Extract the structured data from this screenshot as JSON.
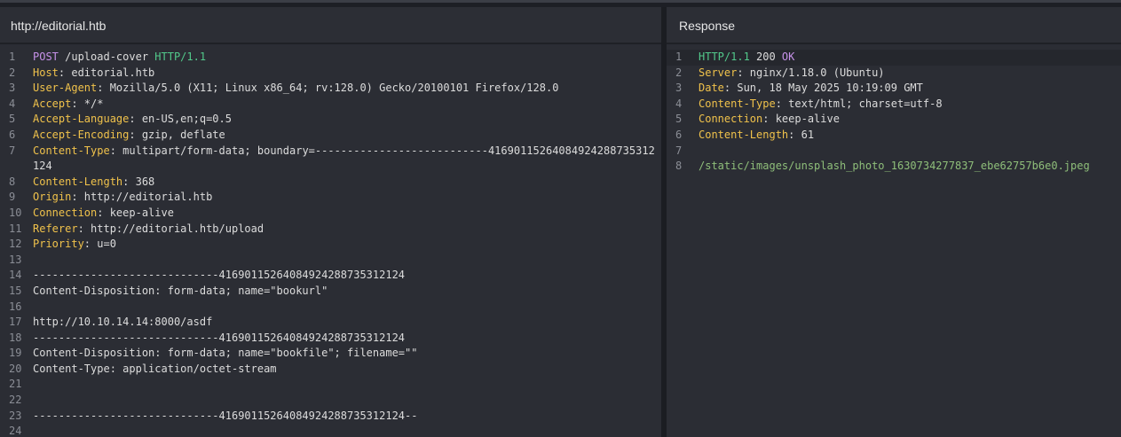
{
  "request": {
    "title": "http://editorial.htb",
    "lines": [
      {
        "n": "1",
        "parts": [
          {
            "t": "POST",
            "c": "method"
          },
          {
            "t": " /upload-cover ",
            "c": "plain"
          },
          {
            "t": "HTTP/1.1",
            "c": "proto"
          }
        ]
      },
      {
        "n": "2",
        "parts": [
          {
            "t": "Host",
            "c": "hname"
          },
          {
            "t": ": editorial.htb",
            "c": "plain"
          }
        ]
      },
      {
        "n": "3",
        "parts": [
          {
            "t": "User-Agent",
            "c": "hname"
          },
          {
            "t": ": Mozilla/5.0 (X11; Linux x86_64; rv:128.0) Gecko/20100101 Firefox/128.0",
            "c": "plain"
          }
        ]
      },
      {
        "n": "4",
        "parts": [
          {
            "t": "Accept",
            "c": "hname"
          },
          {
            "t": ": */*",
            "c": "plain"
          }
        ]
      },
      {
        "n": "5",
        "parts": [
          {
            "t": "Accept-Language",
            "c": "hname"
          },
          {
            "t": ": en-US,en;q=0.5",
            "c": "plain"
          }
        ]
      },
      {
        "n": "6",
        "parts": [
          {
            "t": "Accept-Encoding",
            "c": "hname"
          },
          {
            "t": ": gzip, deflate",
            "c": "plain"
          }
        ]
      },
      {
        "n": "7",
        "parts": [
          {
            "t": "Content-Type",
            "c": "hname"
          },
          {
            "t": ": multipart/form-data; boundary=---------------------------41690115264084924288735312124",
            "c": "plain"
          }
        ]
      },
      {
        "n": "8",
        "parts": [
          {
            "t": "Content-Length",
            "c": "hname"
          },
          {
            "t": ": 368",
            "c": "plain"
          }
        ]
      },
      {
        "n": "9",
        "parts": [
          {
            "t": "Origin",
            "c": "hname"
          },
          {
            "t": ": http://editorial.htb",
            "c": "plain"
          }
        ]
      },
      {
        "n": "10",
        "parts": [
          {
            "t": "Connection",
            "c": "hname"
          },
          {
            "t": ": keep-alive",
            "c": "plain"
          }
        ]
      },
      {
        "n": "11",
        "parts": [
          {
            "t": "Referer",
            "c": "hname"
          },
          {
            "t": ": http://editorial.htb/upload",
            "c": "plain"
          }
        ]
      },
      {
        "n": "12",
        "parts": [
          {
            "t": "Priority",
            "c": "hname"
          },
          {
            "t": ": u=0",
            "c": "plain"
          }
        ]
      },
      {
        "n": "13",
        "parts": []
      },
      {
        "n": "14",
        "parts": [
          {
            "t": "-----------------------------41690115264084924288735312124",
            "c": "plain"
          }
        ]
      },
      {
        "n": "15",
        "parts": [
          {
            "t": "Content-Disposition: form-data; name=\"bookurl\"",
            "c": "plain"
          }
        ]
      },
      {
        "n": "16",
        "parts": []
      },
      {
        "n": "17",
        "parts": [
          {
            "t": "http://10.10.14.14:8000/asdf",
            "c": "plain"
          }
        ]
      },
      {
        "n": "18",
        "parts": [
          {
            "t": "-----------------------------41690115264084924288735312124",
            "c": "plain"
          }
        ]
      },
      {
        "n": "19",
        "parts": [
          {
            "t": "Content-Disposition: form-data; name=\"bookfile\"; filename=\"\"",
            "c": "plain"
          }
        ]
      },
      {
        "n": "20",
        "parts": [
          {
            "t": "Content-Type: application/octet-stream",
            "c": "plain"
          }
        ]
      },
      {
        "n": "21",
        "parts": []
      },
      {
        "n": "22",
        "parts": []
      },
      {
        "n": "23",
        "parts": [
          {
            "t": "-----------------------------41690115264084924288735312124--",
            "c": "plain"
          }
        ]
      },
      {
        "n": "24",
        "parts": []
      }
    ]
  },
  "response": {
    "title": "Response",
    "lines": [
      {
        "n": "1",
        "parts": [
          {
            "t": "HTTP/1.1",
            "c": "proto"
          },
          {
            "t": " 200 ",
            "c": "plain"
          },
          {
            "t": "OK",
            "c": "okword"
          }
        ]
      },
      {
        "n": "2",
        "parts": [
          {
            "t": "Server",
            "c": "hname"
          },
          {
            "t": ": nginx/1.18.0 (Ubuntu)",
            "c": "plain"
          }
        ]
      },
      {
        "n": "3",
        "parts": [
          {
            "t": "Date",
            "c": "hname"
          },
          {
            "t": ": Sun, 18 May 2025 10:19:09 GMT",
            "c": "plain"
          }
        ]
      },
      {
        "n": "4",
        "parts": [
          {
            "t": "Content-Type",
            "c": "hname"
          },
          {
            "t": ": text/html; charset=utf-8",
            "c": "plain"
          }
        ]
      },
      {
        "n": "5",
        "parts": [
          {
            "t": "Connection",
            "c": "hname"
          },
          {
            "t": ": keep-alive",
            "c": "plain"
          }
        ]
      },
      {
        "n": "6",
        "parts": [
          {
            "t": "Content-Length",
            "c": "hname"
          },
          {
            "t": ": 61",
            "c": "plain"
          }
        ]
      },
      {
        "n": "7",
        "parts": []
      },
      {
        "n": "8",
        "parts": [
          {
            "t": "/static/images/unsplash_photo_1630734277837_ebe62757b6e0.jpeg",
            "c": "path"
          }
        ]
      }
    ]
  },
  "colors": {
    "background": "#2b2d34",
    "header_name": "#f0c24b",
    "method": "#c792ea",
    "protocol": "#52c98b",
    "path": "#8fbf7a",
    "line_number": "#8b8e96"
  }
}
